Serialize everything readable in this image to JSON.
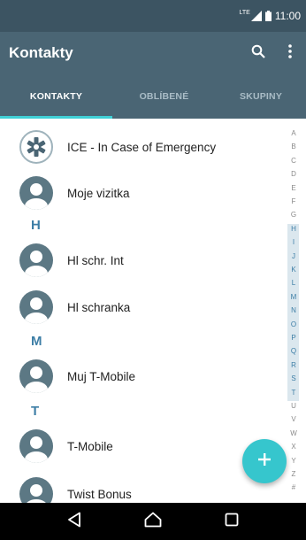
{
  "status_bar": {
    "network": "LTE",
    "time": "11:00"
  },
  "toolbar": {
    "title": "Kontakty",
    "search_icon": "search-icon",
    "more_icon": "more-vert-icon"
  },
  "tabs": [
    {
      "label": "KONTAKTY",
      "active": true
    },
    {
      "label": "OBLÍBENÉ",
      "active": false
    },
    {
      "label": "SKUPINY",
      "active": false
    }
  ],
  "contacts": [
    {
      "name": "ICE - In Case of Emergency",
      "icon": "ice-icon"
    },
    {
      "name": "Moje vizitka",
      "icon": "person-icon"
    },
    {
      "section": "H"
    },
    {
      "name": "Hl schr. Int",
      "icon": "person-icon"
    },
    {
      "name": "Hl schranka",
      "icon": "person-icon"
    },
    {
      "section": "M"
    },
    {
      "name": "Muj T-Mobile",
      "icon": "person-icon"
    },
    {
      "section": "T"
    },
    {
      "name": "T-Mobile",
      "icon": "person-icon"
    },
    {
      "name": "Twist Bonus",
      "icon": "person-icon"
    }
  ],
  "alphabet_index": [
    "A",
    "B",
    "C",
    "D",
    "E",
    "F",
    "G",
    "H",
    "I",
    "J",
    "K",
    "L",
    "M",
    "N",
    "O",
    "P",
    "Q",
    "R",
    "S",
    "T",
    "U",
    "V",
    "W",
    "X",
    "Y",
    "Z",
    "#"
  ],
  "highlighted_range": [
    "H",
    "T"
  ],
  "fab": {
    "icon": "add-icon",
    "symbol": "+"
  },
  "colors": {
    "toolbar": "#4a6574",
    "status_bar": "#3c5462",
    "accent": "#3fd0d6",
    "fab": "#36c6cd",
    "section_letter": "#3d7ea6"
  },
  "navbar": {
    "back_icon": "back-icon",
    "home_icon": "home-icon",
    "recents_icon": "recents-icon"
  }
}
